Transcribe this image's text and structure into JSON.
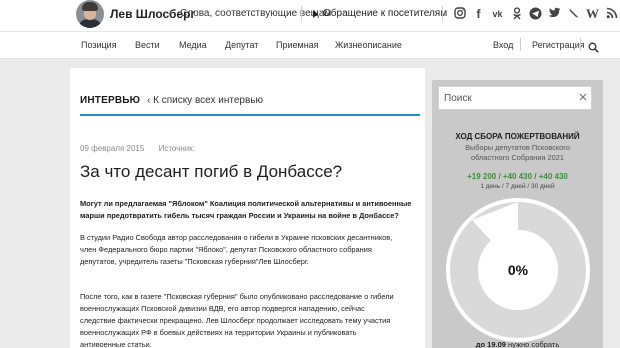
{
  "header": {
    "name": "Лев Шлосберг",
    "subtitle": "Слова, соответствующие вещам",
    "appeal": "Обращение к посетителям",
    "socials": [
      "instagram-icon",
      "facebook-icon",
      "vk-icon",
      "odnoklassniki-icon",
      "telegram-icon",
      "twitter-icon",
      "livejournal-icon",
      "wikipedia-icon",
      "rss-icon"
    ]
  },
  "nav": {
    "items": [
      "Позиция",
      "Вести",
      "Медиа",
      "Депутат",
      "Приемная",
      "Жизнеописание"
    ],
    "login": "Вход",
    "register": "Регистрация"
  },
  "article": {
    "section": "ИНТЕРВЬЮ",
    "back": "К списку всех интервью",
    "date": "09 февраля 2015",
    "source_label": "Источник:",
    "title": "За что десант погиб в Донбассе?",
    "lead_1": "Могут ли предлагаемая \"Яблоком\" Коалиция политической альтернативы и антивоенные",
    "lead_2": "марши предотвратить гибель тысяч граждан России и Украины на войне в Донбассе?",
    "p2_1": "В студии Радио Свобода автор расследования о гибели в Украине псковских десантников,",
    "p2_2": "член Федерального бюро партии \"Яблоко\", депутат Псковского областного собрания",
    "p2_3": "депутатов, учредитель газеты \"Псковская губерния\"Лев Шлосберг.",
    "p3_1": "После того, как в газете \"Псковская губерния\" было опубликовано расследование о гибели",
    "p3_2": "военнослужащих Псковской дивизии ВДВ, его  автор подвергся нападению, сейчас",
    "p3_3": "следствие фактически прекращено. Лев Шлосберг продолжает исследовать тему участия",
    "p3_4": "военнослужащих РФ в боевых действиях на территории Украины и публиковать",
    "p3_5": "антивоенные статьи."
  },
  "sidebar": {
    "search_placeholder": "Поиск",
    "donation_title": "ХОД СБОРА ПОЖЕРТВОВАНИЙ",
    "donation_sub_1": "Выборы депутатов Псковского",
    "donation_sub_2": "областного Собрания 2021",
    "donation_numbers": "+19 200 / +40 430 / +40 430",
    "donation_period": "1 день / 7 дней / 30 дней",
    "donation_percent": "0%",
    "donation_progress": 0,
    "footer_date": "до 19.09",
    "footer_text": "нужно собрать"
  },
  "colors": {
    "accent": "#2b88c8",
    "positive": "#3f8f3a",
    "sidebar_bg": "#c9c9c9"
  }
}
